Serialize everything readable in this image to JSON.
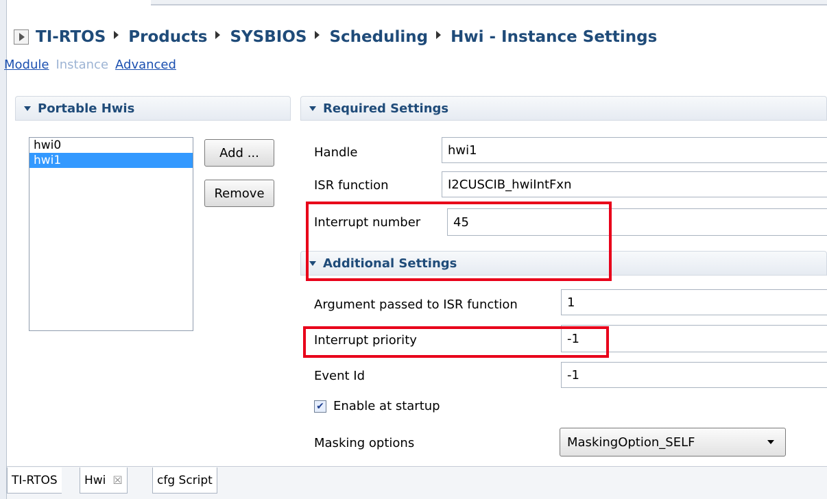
{
  "breadcrumb": {
    "items": [
      "TI-RTOS",
      "Products",
      "SYSBIOS",
      "Scheduling",
      "Hwi - Instance Settings"
    ]
  },
  "view_tabs": {
    "module": "Module",
    "instance": "Instance",
    "advanced": "Advanced"
  },
  "portable": {
    "title": "Portable Hwis",
    "items": [
      "hwi0",
      "hwi1"
    ],
    "selected": "hwi1",
    "add_label": "Add ...",
    "remove_label": "Remove"
  },
  "required": {
    "title": "Required Settings",
    "handle_label": "Handle",
    "handle_value": "hwi1",
    "isr_label": "ISR function",
    "isr_value": "I2CUSCIB_hwiIntFxn",
    "intnum_label": "Interrupt number",
    "intnum_value": "45"
  },
  "additional": {
    "title": "Additional Settings",
    "arg_label": "Argument passed to ISR function",
    "arg_value": "1",
    "prio_label": "Interrupt priority",
    "prio_value": "-1",
    "event_label": "Event Id",
    "event_value": "-1",
    "enable_label": "Enable at startup",
    "enable_checked": true,
    "mask_label": "Masking options",
    "mask_value": "MaskingOption_SELF"
  },
  "bottom_tabs": {
    "tirtos": "TI-RTOS",
    "hwi": "Hwi",
    "cfg": "cfg Script"
  },
  "colors": {
    "highlight": "#e8001a",
    "selection": "#3399ff",
    "header_text": "#1f4b79"
  }
}
